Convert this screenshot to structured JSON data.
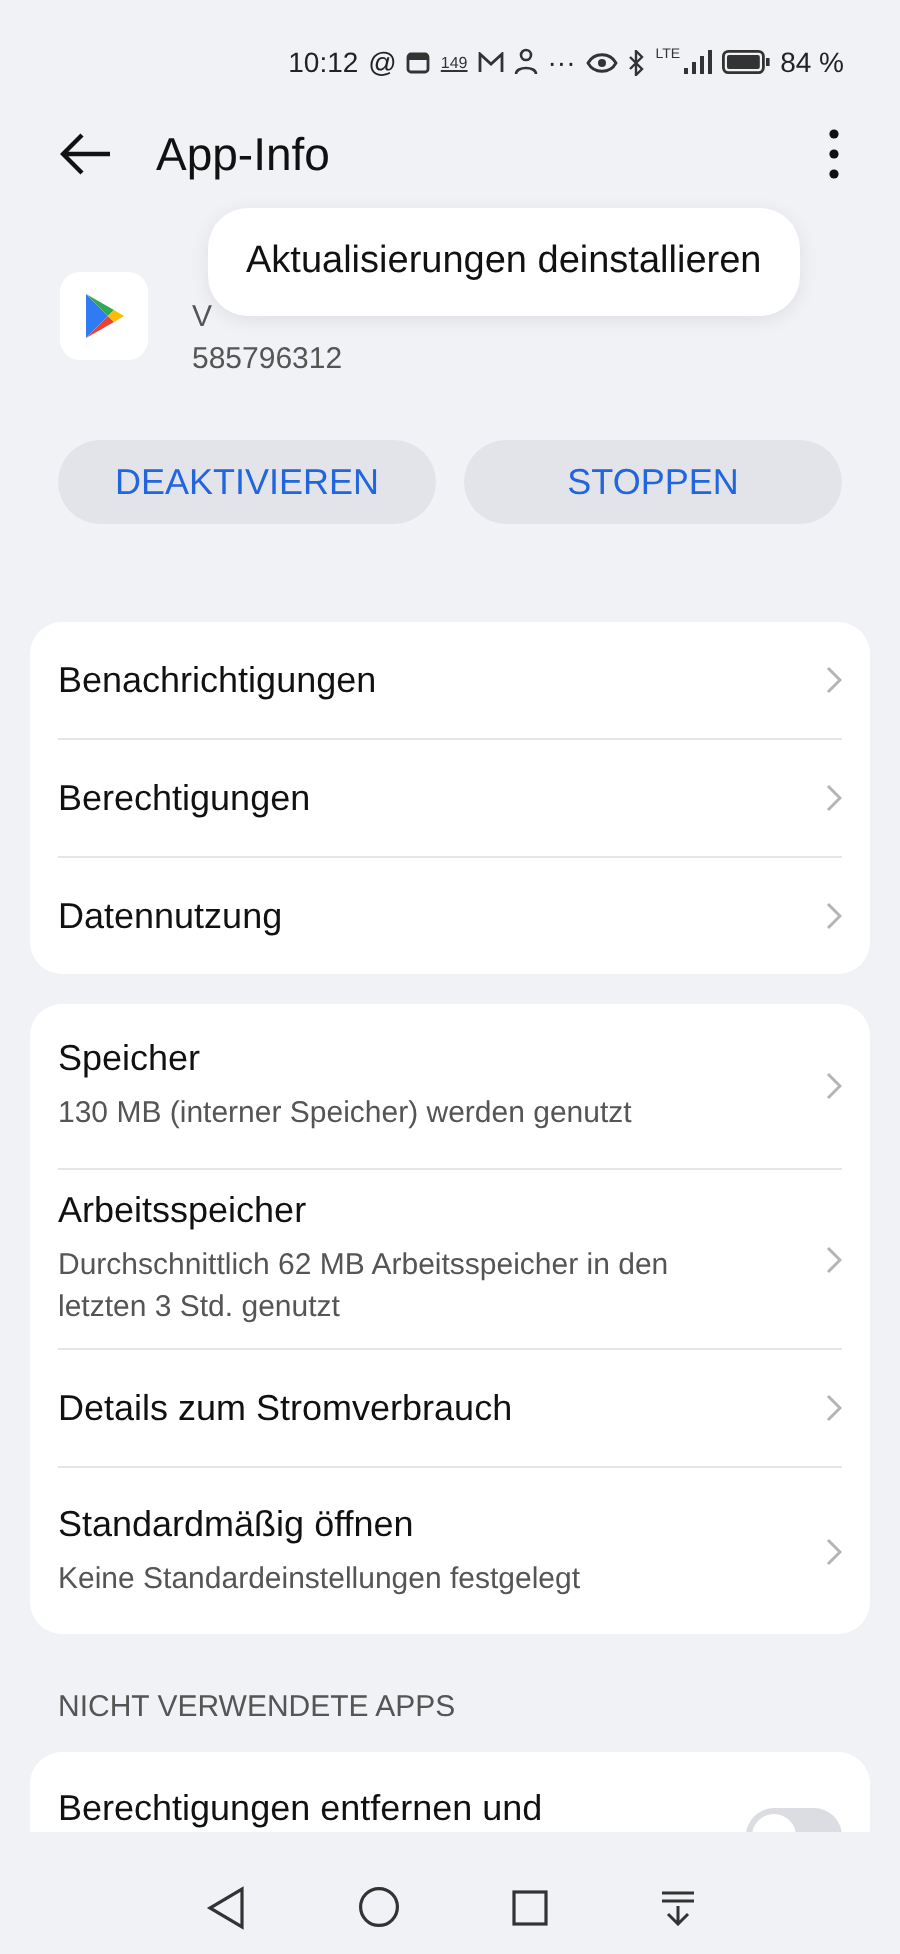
{
  "status_bar": {
    "time": "10:12",
    "at_sign": "@",
    "badge": "149",
    "more": "···",
    "network": "LTE",
    "battery": "84 %"
  },
  "header": {
    "title": "App-Info"
  },
  "app": {
    "version": "V",
    "code": "585796312"
  },
  "popup_menu": {
    "items": [
      "Aktualisierungen deinstallieren"
    ]
  },
  "buttons": [
    "DEAKTIVIEREN",
    "STOPPEN"
  ],
  "cards": [
    [
      {
        "title": "Benachrichtigungen"
      },
      {
        "title": "Berechtigungen"
      },
      {
        "title": "Datennutzung"
      }
    ],
    [
      {
        "title": "Speicher",
        "subtitle": "130 MB (interner Speicher) werden genutzt"
      },
      {
        "title": "Arbeitsspeicher",
        "subtitle": "Durchschnittlich 62 MB Arbeitsspeicher in den letzten 3 Std. genutzt"
      },
      {
        "title": "Details zum Stromverbrauch"
      },
      {
        "title": "Standardmäßig öffnen",
        "subtitle": "Keine Standardeinstellungen festgelegt"
      }
    ]
  ],
  "section": {
    "title": "NICHT VERWENDETE APPS",
    "items": [
      {
        "title": "Berechtigungen entfernen und",
        "on": false
      }
    ]
  }
}
